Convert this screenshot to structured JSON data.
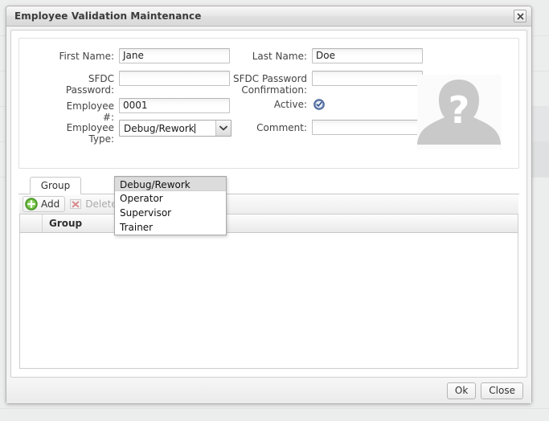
{
  "backdrop": {
    "note": "faint list page behind modal"
  },
  "dialog": {
    "title": "Employee Validation Maintenance",
    "close_icon": "close-icon"
  },
  "form": {
    "first_name": {
      "label": "First Name:",
      "value": "Jane"
    },
    "last_name": {
      "label": "Last Name:",
      "value": "Doe"
    },
    "sfdc_password": {
      "label": "SFDC Password:",
      "value": ""
    },
    "sfdc_password_confirmation": {
      "label": "SFDC Password Confirmation:",
      "value": ""
    },
    "employee_number": {
      "label": "Employee #:",
      "value": "0001"
    },
    "active": {
      "label": "Active:",
      "checked": true,
      "icon": "check-circle-icon"
    },
    "employee_type": {
      "label": "Employee Type:",
      "value": "Debug/Rework",
      "expanded": true,
      "options": [
        "Debug/Rework",
        "Operator",
        "Supervisor",
        "Trainer"
      ],
      "selected_index": 0
    },
    "comment": {
      "label": "Comment:",
      "value": ""
    },
    "avatar": {
      "icon": "user-placeholder-icon",
      "glyph": "?"
    }
  },
  "tabs": [
    {
      "label": "Group",
      "active": true
    }
  ],
  "toolbar": {
    "add": {
      "label": "Add",
      "icon": "add-circle-icon",
      "enabled": true
    },
    "delete": {
      "label": "Delete",
      "icon": "delete-x-icon",
      "enabled": false
    }
  },
  "grid": {
    "columns": [
      "",
      "Group"
    ],
    "rows": []
  },
  "footer": {
    "ok_label": "Ok",
    "close_label": "Close"
  },
  "colors": {
    "accent_green": "#5aa832",
    "accent_blue": "#3f6fb5",
    "accent_red": "#d05a5a",
    "title_text": "#3b3b3b"
  }
}
